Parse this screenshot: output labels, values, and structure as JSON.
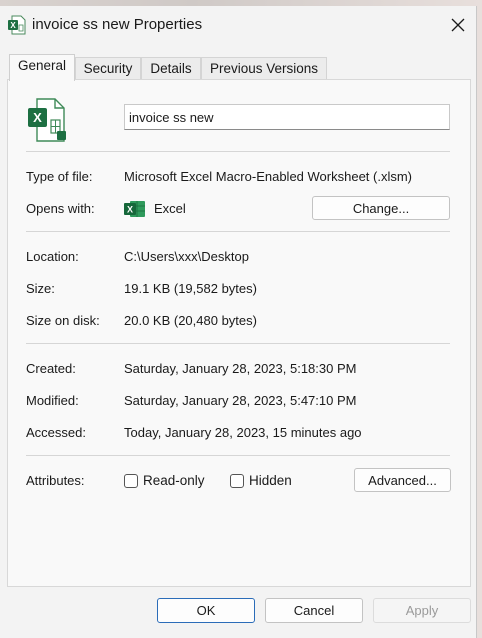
{
  "window": {
    "title": "invoice ss new Properties",
    "close_glyph": "✕"
  },
  "tabs": [
    {
      "label": "General",
      "active": true
    },
    {
      "label": "Security",
      "active": false
    },
    {
      "label": "Details",
      "active": false
    },
    {
      "label": "Previous Versions",
      "active": false
    }
  ],
  "general": {
    "file_name": "invoice ss new",
    "type_of_file_label": "Type of file:",
    "type_of_file_value": "Microsoft Excel Macro-Enabled Worksheet (.xlsm)",
    "opens_with_label": "Opens with:",
    "opens_with_value": "Excel",
    "change_button": "Change...",
    "location_label": "Location:",
    "location_value": "C:\\Users\\xxx\\Desktop",
    "size_label": "Size:",
    "size_value": "19.1 KB (19,582 bytes)",
    "size_on_disk_label": "Size on disk:",
    "size_on_disk_value": "20.0 KB (20,480 bytes)",
    "created_label": "Created:",
    "created_value": "Saturday, January 28, 2023, 5:18:30 PM",
    "modified_label": "Modified:",
    "modified_value": "Saturday, January 28, 2023, 5:47:10 PM",
    "accessed_label": "Accessed:",
    "accessed_value": "Today, January 28, 2023, 15 minutes ago",
    "attributes_label": "Attributes:",
    "readonly_label": "Read-only",
    "readonly_checked": false,
    "hidden_label": "Hidden",
    "hidden_checked": false,
    "advanced_button": "Advanced..."
  },
  "footer": {
    "ok": "OK",
    "cancel": "Cancel",
    "apply": "Apply"
  },
  "icons": {
    "title": "excel-file-icon",
    "file": "excel-file-icon",
    "app": "excel-app-icon",
    "close": "close-icon"
  },
  "colors": {
    "excel_green": "#1d6f42",
    "ok_border": "#2b6cb8"
  }
}
